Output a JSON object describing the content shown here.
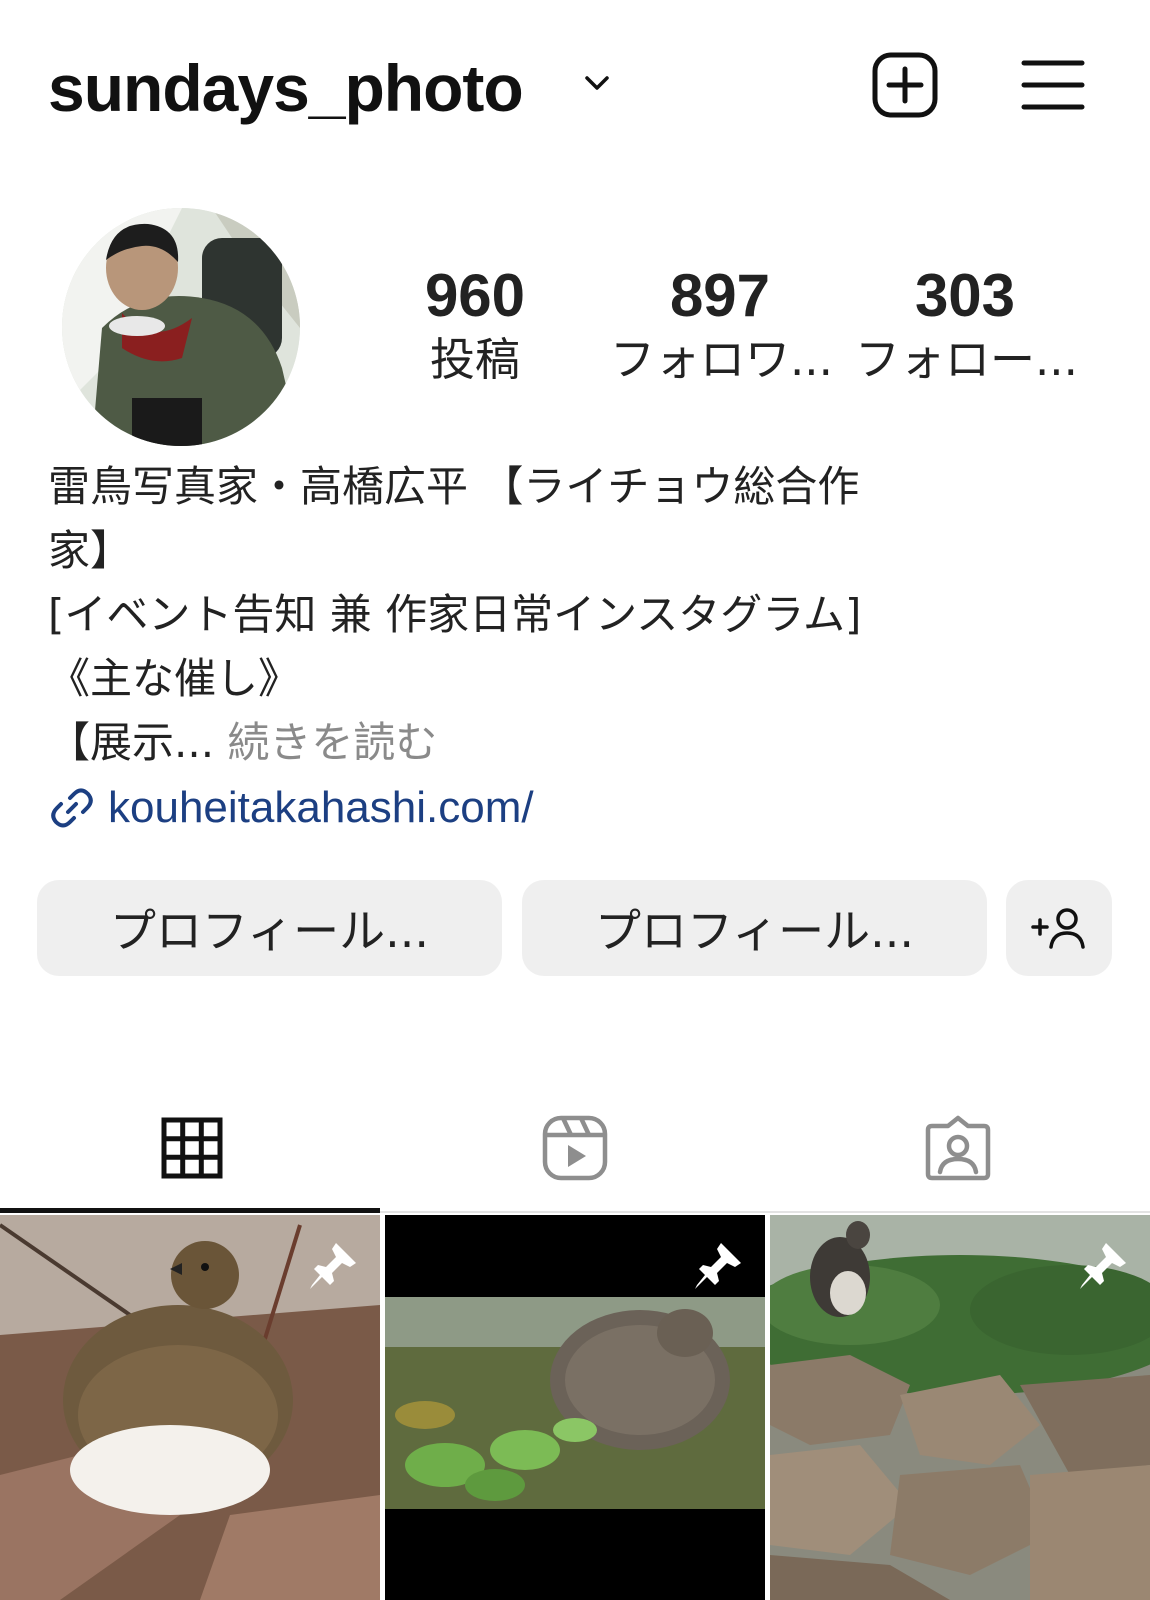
{
  "header": {
    "username": "sundays_photo",
    "icons": [
      "chevron-down-icon",
      "new-post-icon",
      "menu-icon"
    ]
  },
  "profile": {
    "stats": [
      {
        "value": "960",
        "label": "投稿"
      },
      {
        "value": "897",
        "label": "フォロワ..."
      },
      {
        "value": "303",
        "label": "フォロー..."
      }
    ]
  },
  "bio": {
    "lines": [
      "雷鳥写真家・高橋広平 【ライチョウ総合作",
      "家】",
      "[イベント告知 兼 作家日常インスタグラム]",
      "《主な催し》",
      "【展示..."
    ],
    "more_label": "続きを読む",
    "link": "kouheitakahashi.com/"
  },
  "actions": {
    "button1": "プロフィール...",
    "button2": "プロフィール..."
  },
  "tabs": [
    "grid-icon",
    "reels-icon",
    "tagged-icon"
  ],
  "colors": {
    "link": "#1c3f82",
    "button_bg": "#efefef",
    "muted": "#8a8a8a"
  }
}
